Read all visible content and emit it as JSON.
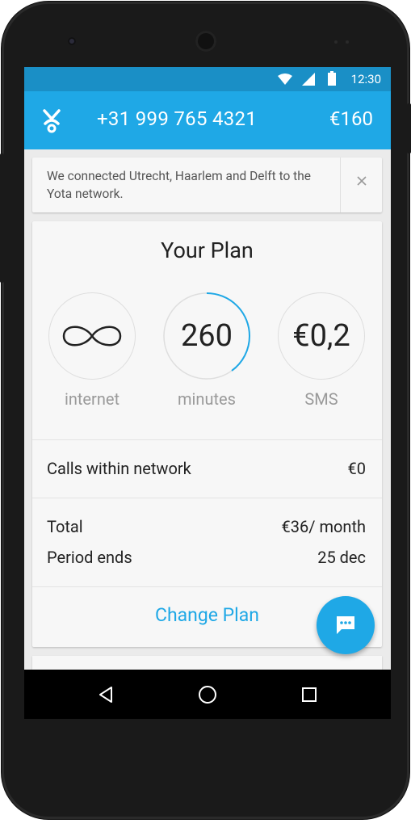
{
  "status_bar": {
    "time": "12:30"
  },
  "app_bar": {
    "phone_number": "+31 999 765 4321",
    "balance": "€160"
  },
  "notice": {
    "text": "We connected Utrecht, Haarlem and Delft to the Yota network."
  },
  "plan": {
    "title": "Your Plan",
    "stats": [
      {
        "value": "",
        "label": "internet",
        "icon": "infinity-icon"
      },
      {
        "value": "260",
        "label": "minutes",
        "progress": 0.4
      },
      {
        "value": "€0,2",
        "label": "SMS"
      }
    ],
    "calls": {
      "label": "Calls within network",
      "value": "€0"
    },
    "total": {
      "label": "Total",
      "value": "€36/ month"
    },
    "period": {
      "label": "Period ends",
      "value": "25 dec"
    },
    "change_label": "Change Plan"
  },
  "colors": {
    "accent": "#1fa8e6",
    "status_bar": "#1a8fc6"
  },
  "icons": {
    "fab": "chat-icon",
    "nav": [
      "back-icon",
      "home-icon",
      "recents-icon"
    ]
  }
}
